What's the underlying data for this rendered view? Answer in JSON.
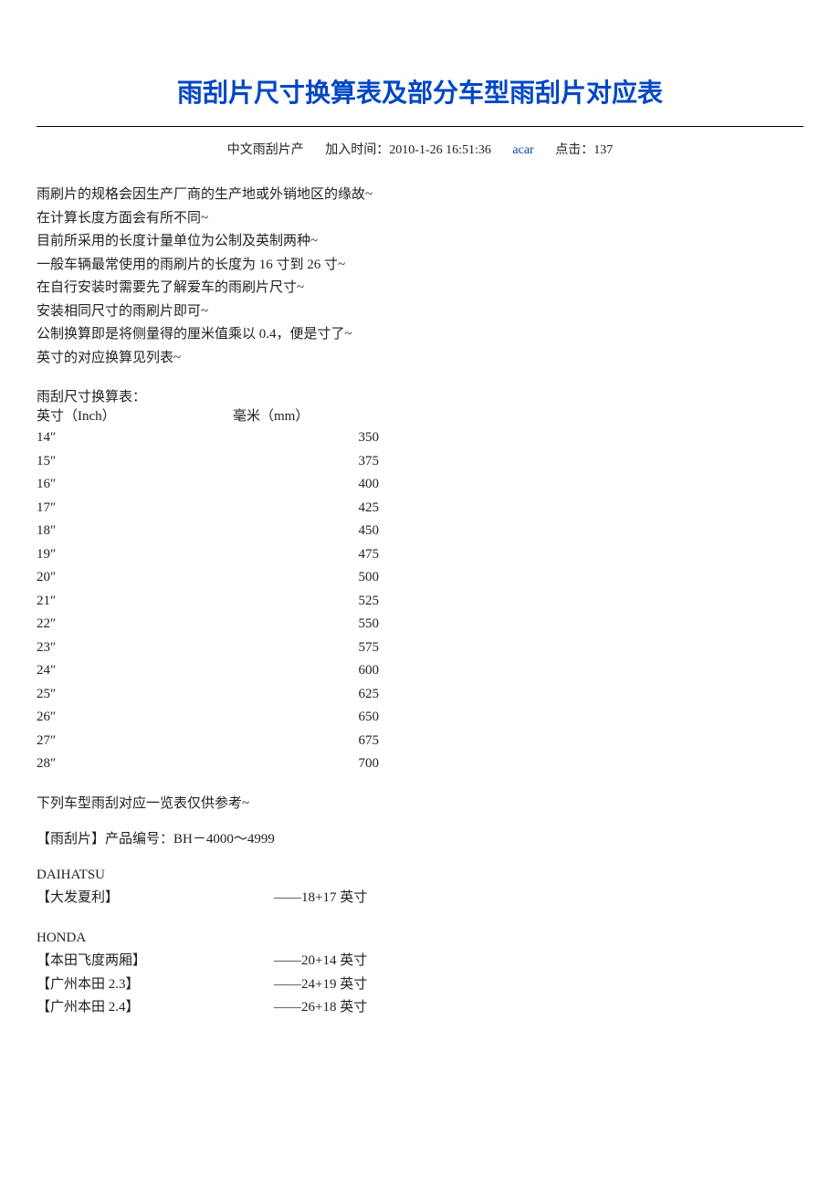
{
  "title": "雨刮片尺寸换算表及部分车型雨刮片对应表",
  "meta": {
    "category": "中文雨刮片产",
    "add_time_label": "加入时间：",
    "add_time_value": "2010-1-26 16:51:36",
    "author": "acar",
    "hits_label": "点击：",
    "hits_value": "137"
  },
  "intro_lines": [
    "雨刷片的规格会因生产厂商的生产地或外销地区的缘故~",
    "在计算长度方面会有所不同~",
    "目前所采用的长度计量单位为公制及英制两种~",
    "一般车辆最常使用的雨刷片的长度为 16 寸到 26 寸~",
    "在自行安装时需要先了解爱车的雨刷片尺寸~",
    "安装相同尺寸的雨刷片即可~",
    "公制换算即是将侧量得的厘米值乘以 0.4，便是寸了~",
    "英寸的对应换算见列表~"
  ],
  "conv_title": "雨刮尺寸换算表：",
  "conv_head_inch": "英寸（Inch）",
  "conv_head_mm": "毫米（mm）",
  "chart_data": {
    "type": "table",
    "title": "雨刮尺寸换算表",
    "columns": [
      "英寸（Inch）",
      "毫米（mm）"
    ],
    "rows": [
      {
        "inch": "14″",
        "mm": "350"
      },
      {
        "inch": "15″",
        "mm": "375"
      },
      {
        "inch": "16″",
        "mm": "400"
      },
      {
        "inch": "17″",
        "mm": "425"
      },
      {
        "inch": "18″",
        "mm": "450"
      },
      {
        "inch": "19″",
        "mm": "475"
      },
      {
        "inch": "20″",
        "mm": "500"
      },
      {
        "inch": "21″",
        "mm": "525"
      },
      {
        "inch": "22″",
        "mm": "550"
      },
      {
        "inch": "23″",
        "mm": "575"
      },
      {
        "inch": "24″",
        "mm": "600"
      },
      {
        "inch": "25″",
        "mm": "625"
      },
      {
        "inch": "26″",
        "mm": "650"
      },
      {
        "inch": "27″",
        "mm": "675"
      },
      {
        "inch": "28″",
        "mm": "700"
      }
    ]
  },
  "ref_note": "下列车型雨刮对应一览表仅供参考~",
  "product_line": "【雨刮片】产品编号：BH－4000～4999",
  "brands": [
    {
      "name": "DAIHATSU",
      "models": [
        {
          "model": "【大发夏利】",
          "size": "——18+17 英寸"
        }
      ]
    },
    {
      "name": "HONDA",
      "models": [
        {
          "model": "【本田飞度两厢】",
          "size": "——20+14 英寸"
        },
        {
          "model": "【广州本田 2.3】",
          "size": "——24+19 英寸"
        },
        {
          "model": "【广州本田 2.4】",
          "size": "——26+18 英寸"
        }
      ]
    }
  ]
}
